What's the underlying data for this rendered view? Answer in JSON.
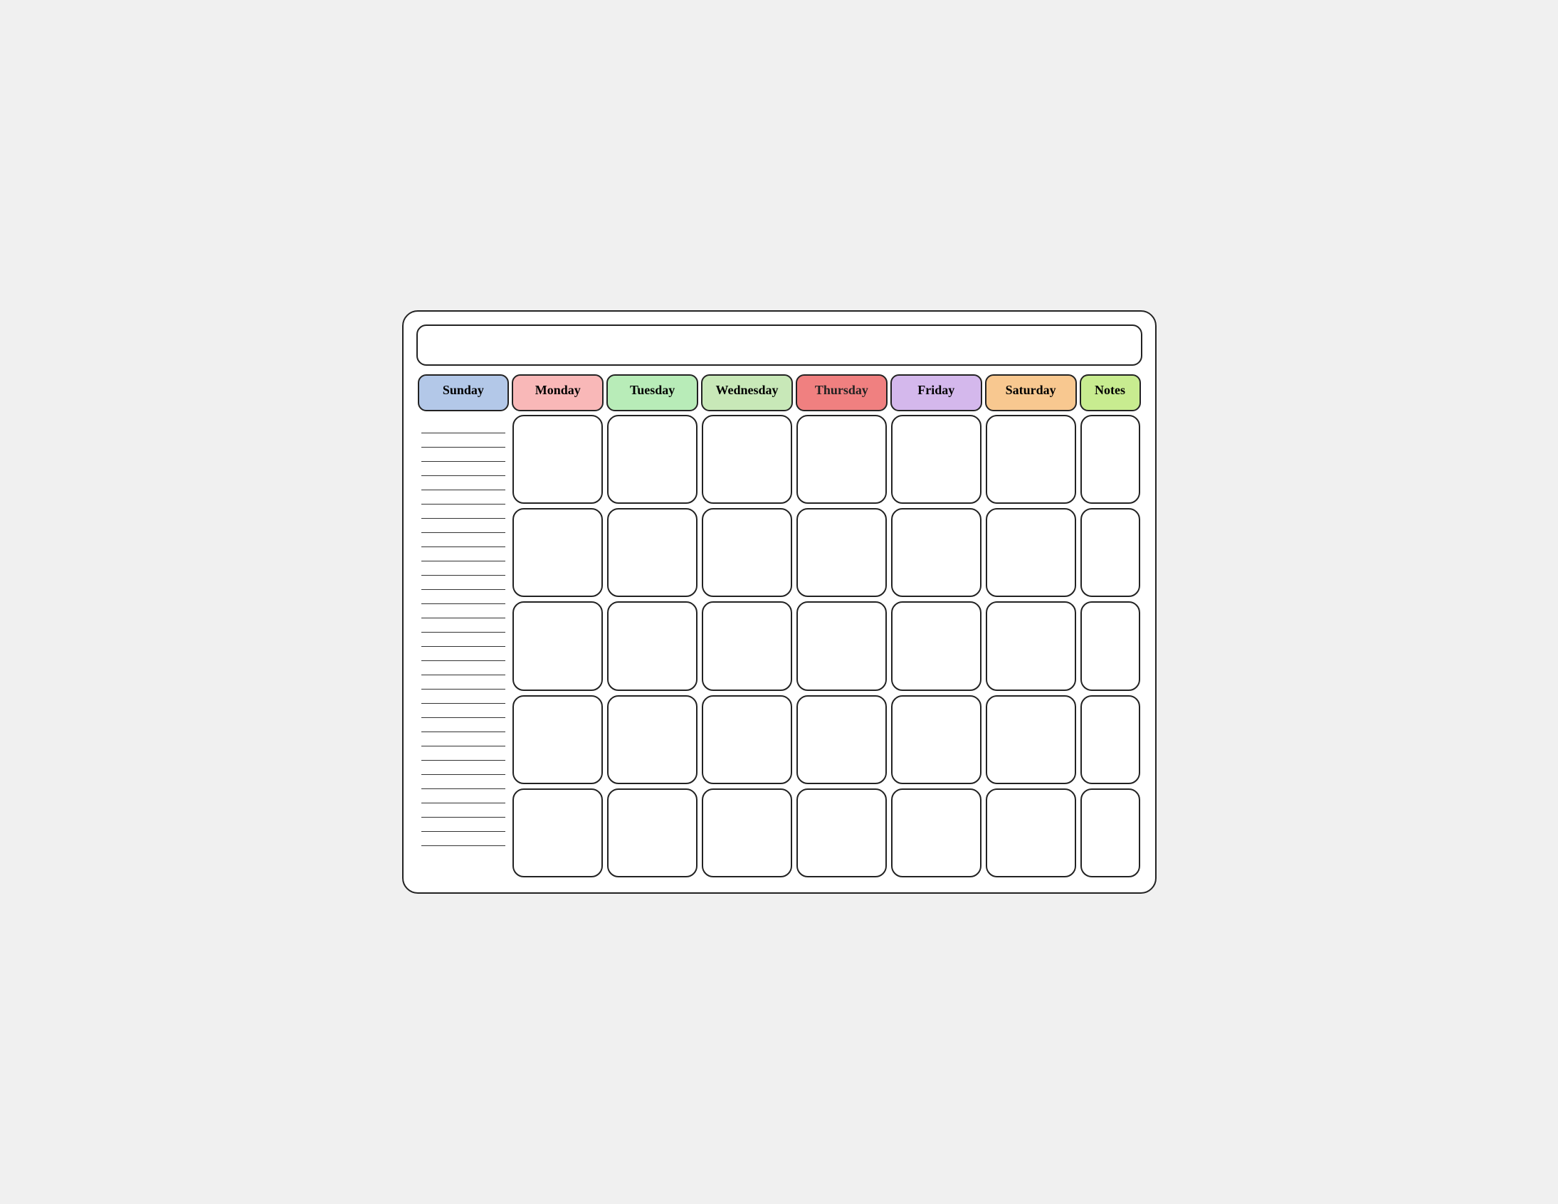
{
  "header": {
    "title": ""
  },
  "days": {
    "headers": [
      "Sunday",
      "Monday",
      "Tuesday",
      "Wednesday",
      "Thursday",
      "Friday",
      "Saturday",
      "Notes"
    ],
    "header_classes": [
      "header-sunday",
      "header-monday",
      "header-tuesday",
      "header-wednesday",
      "header-thursday",
      "header-friday",
      "header-saturday",
      "header-notes"
    ]
  },
  "rows": 5,
  "notes_lines": 30
}
